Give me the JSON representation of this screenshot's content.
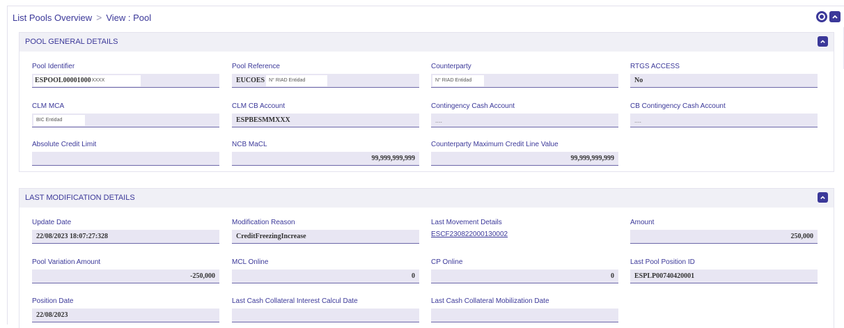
{
  "breadcrumb": {
    "parent": "List Pools Overview",
    "separator": ">",
    "current": "View : Pool"
  },
  "general": {
    "title": "POOL GENERAL DETAILS",
    "pool_identifier": {
      "label": "Pool Identifier",
      "value": "ESPOOL00001000",
      "tag": "XXXX"
    },
    "pool_reference": {
      "label": "Pool Reference",
      "value": "EUCOES",
      "tag": "N° RIAD Entidad"
    },
    "counterparty": {
      "label": "Counterparty",
      "tag": "N° RIAD Entidad"
    },
    "rtgs_access": {
      "label": "RTGS ACCESS",
      "value": "No"
    },
    "clm_mca": {
      "label": "CLM MCA",
      "tag": "BIC Entidad"
    },
    "clm_cb_account": {
      "label": "CLM CB Account",
      "value": "ESPBESMMXXX"
    },
    "contingency_cash_account": {
      "label": "Contingency Cash Account",
      "value": "...."
    },
    "cb_contingency_cash_account": {
      "label": "CB Contingency Cash Account",
      "value": "...."
    },
    "absolute_credit_limit": {
      "label": "Absolute Credit Limit",
      "value": ""
    },
    "ncb_macl": {
      "label": "NCB MaCL",
      "value": "99,999,999,999"
    },
    "counterparty_max_credit": {
      "label": "Counterparty Maximum Credit Line Value",
      "value": "99,999,999,999"
    }
  },
  "modification": {
    "title": "LAST MODIFICATION DETAILS",
    "update_date": {
      "label": "Update Date",
      "value": "22/08/2023 18:07:27:328"
    },
    "modification_reason": {
      "label": "Modification Reason",
      "value": "CreditFreezingIncrease"
    },
    "last_movement_details": {
      "label": "Last Movement Details",
      "value": "ESCF230822000130002"
    },
    "amount": {
      "label": "Amount",
      "value": "250,000"
    },
    "pool_variation_amount": {
      "label": "Pool Variation Amount",
      "value": "-250,000"
    },
    "mcl_online": {
      "label": "MCL Online",
      "value": "0"
    },
    "cp_online": {
      "label": "CP Online",
      "value": "0"
    },
    "last_pool_position_id": {
      "label": "Last Pool Position ID",
      "value": "ESPLP00740420001"
    },
    "position_date": {
      "label": "Position Date",
      "value": "22/08/2023"
    },
    "last_cash_collateral_interest": {
      "label": "Last Cash Collateral Interest Calcul Date",
      "value": ""
    },
    "last_cash_collateral_mobilization": {
      "label": "Last Cash Collateral Mobilization Date",
      "value": ""
    }
  },
  "colors": {
    "accent": "#3b3899",
    "field_bg": "#e8e6f3",
    "header_bg": "#f0f0f6"
  },
  "icons": {
    "refresh": "refresh-icon",
    "expand": "expand-icon",
    "collapse": "chevron-up-icon"
  }
}
